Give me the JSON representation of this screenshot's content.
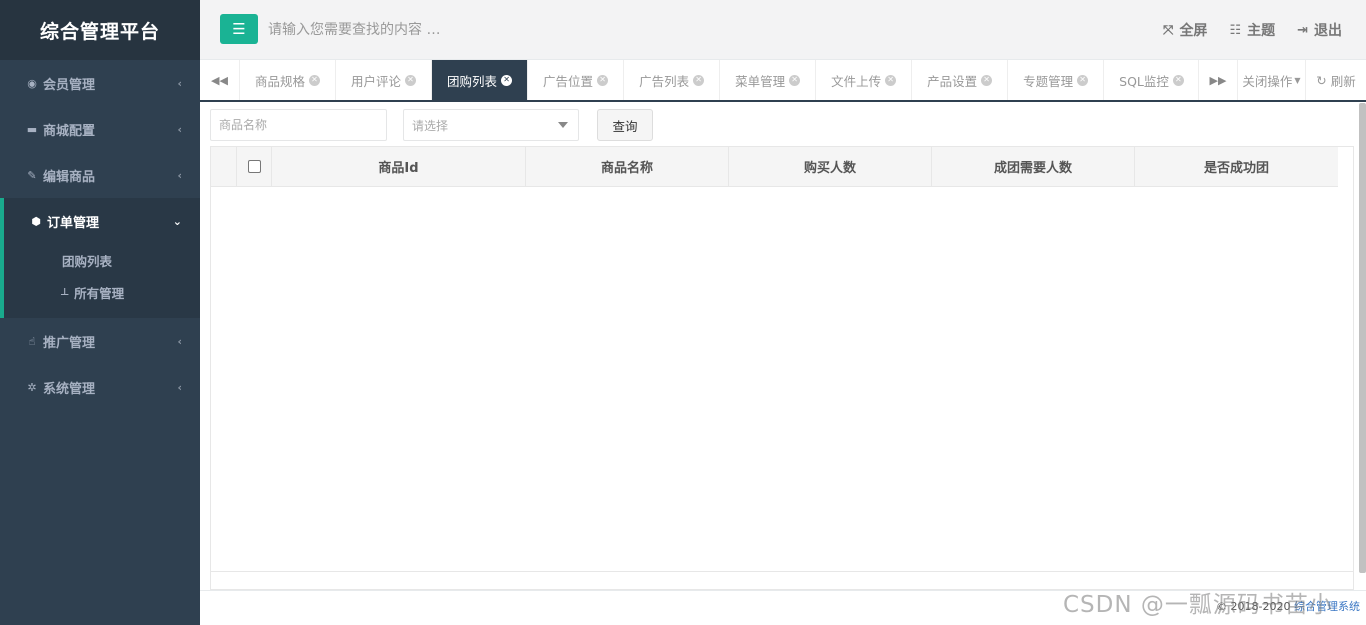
{
  "sidebar": {
    "brand": "综合管理平台",
    "items": [
      {
        "label": "会员管理",
        "icon": "user-circle-icon"
      },
      {
        "label": "商城配置",
        "icon": "cart-icon"
      },
      {
        "label": "编辑商品",
        "icon": "edit-icon"
      },
      {
        "label": "订单管理",
        "icon": "cube-icon",
        "expanded": true,
        "children": [
          {
            "label": "团购列表"
          },
          {
            "label": "所有管理",
            "icon": "sitemap-icon"
          }
        ]
      },
      {
        "label": "推广管理",
        "icon": "hand-icon"
      },
      {
        "label": "系统管理",
        "icon": "gear-icon"
      }
    ]
  },
  "header": {
    "search_placeholder": "请输入您需要查找的内容 …",
    "actions": {
      "fullscreen": "全屏",
      "theme": "主题",
      "logout": "退出"
    }
  },
  "tabs": {
    "items": [
      {
        "label": "商品规格"
      },
      {
        "label": "用户评论"
      },
      {
        "label": "团购列表",
        "active": true
      },
      {
        "label": "广告位置"
      },
      {
        "label": "广告列表"
      },
      {
        "label": "菜单管理"
      },
      {
        "label": "文件上传"
      },
      {
        "label": "产品设置"
      },
      {
        "label": "专题管理"
      },
      {
        "label": "SQL监控"
      }
    ],
    "close_ops": "关闭操作",
    "refresh": "刷新"
  },
  "filters": {
    "name_placeholder": "商品名称",
    "select_placeholder": "请选择",
    "query_label": "查询"
  },
  "table": {
    "columns": [
      "商品Id",
      "商品名称",
      "购买人数",
      "成团需要人数",
      "是否成功团"
    ],
    "rows": []
  },
  "footer": {
    "copyright": "© 2018-2020 ",
    "link": "综合管理系统"
  },
  "watermark": "CSDN @一瓢源码书苗小",
  "colors": {
    "sidebar_bg": "#2f4050",
    "accent": "#1ab394",
    "active_tab": "#2f4050"
  }
}
